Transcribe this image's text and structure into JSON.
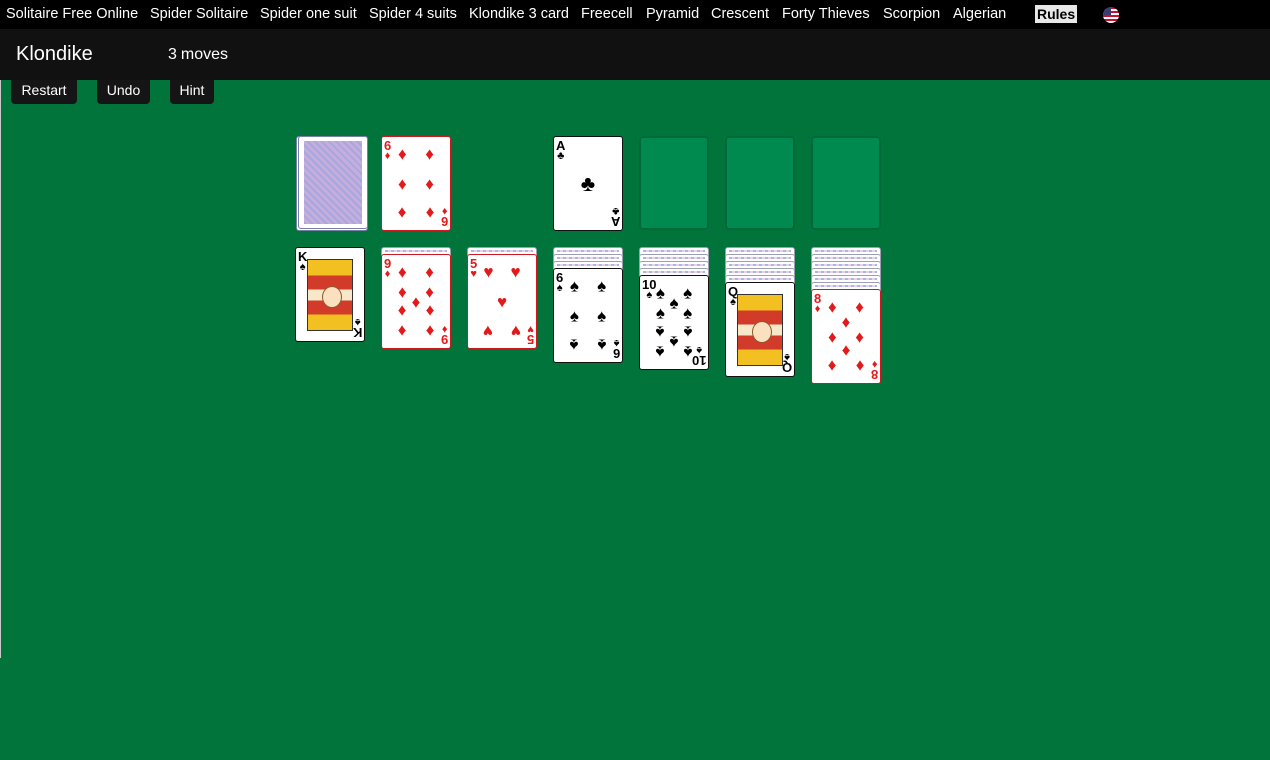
{
  "nav": {
    "links": [
      "Solitaire Free Online",
      "Spider Solitaire",
      "Spider one suit",
      "Spider 4 suits",
      "Klondike 3 card",
      "Freecell",
      "Pyramid",
      "Crescent",
      "Forty Thieves",
      "Scorpion",
      "Algerian"
    ],
    "rules_label": "Rules",
    "language_icon": "us-flag-icon"
  },
  "header": {
    "title": "Klondike",
    "moves_count": "3",
    "moves_label": "moves"
  },
  "controls": {
    "restart_label": "Restart",
    "undo_label": "Undo",
    "hint_label": "Hint"
  },
  "table_color": "#00743a",
  "game": {
    "stock": {
      "face_down": true
    },
    "waste": {
      "rank": "6",
      "suit": "♦",
      "color": "red"
    },
    "foundations": [
      {
        "rank": "A",
        "suit": "♣",
        "color": "black"
      },
      null,
      null,
      null
    ],
    "tableau": [
      {
        "hidden": 0,
        "rank": "K",
        "suit": "♠",
        "color": "black"
      },
      {
        "hidden": 1,
        "rank": "9",
        "suit": "♦",
        "color": "red"
      },
      {
        "hidden": 1,
        "rank": "5",
        "suit": "♥",
        "color": "red"
      },
      {
        "hidden": 3,
        "rank": "6",
        "suit": "♠",
        "color": "black"
      },
      {
        "hidden": 4,
        "rank": "10",
        "suit": "♠",
        "color": "black"
      },
      {
        "hidden": 5,
        "rank": "Q",
        "suit": "♠",
        "color": "black"
      },
      {
        "hidden": 6,
        "rank": "8",
        "suit": "♦",
        "color": "red"
      }
    ]
  }
}
